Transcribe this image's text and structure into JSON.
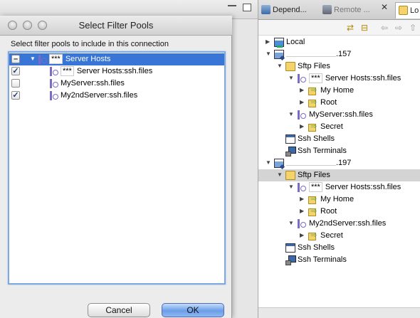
{
  "right_view": {
    "tabs": [
      "Depend...",
      "Remote ...",
      "Lo"
    ],
    "close_glyph": "✕",
    "tree": [
      {
        "label": "Local",
        "icon": "local-system-icon"
      },
      {
        "label": ".157",
        "icon": "remote-host-icon"
      },
      {
        "label": "Sftp Files",
        "icon": "folder-icon"
      },
      {
        "stars": "***",
        "label": "Server Hosts:ssh.files",
        "icon": "filter-pool-icon"
      },
      {
        "label": "My Home",
        "icon": "filter-icon"
      },
      {
        "label": "Root",
        "icon": "filter-icon"
      },
      {
        "label": "MyServer:ssh.files",
        "icon": "filter-pool-icon"
      },
      {
        "label": "Secret",
        "icon": "filter-icon"
      },
      {
        "label": "Ssh Shells",
        "icon": "shell-icon"
      },
      {
        "label": "Ssh Terminals",
        "icon": "terminal-icon"
      },
      {
        "label": ".197",
        "icon": "remote-host-icon"
      },
      {
        "label": "Sftp Files",
        "icon": "folder-icon"
      },
      {
        "stars": "***",
        "label": "Server Hosts:ssh.files",
        "icon": "filter-pool-icon"
      },
      {
        "label": "My Home",
        "icon": "filter-icon"
      },
      {
        "label": "Root",
        "icon": "filter-icon"
      },
      {
        "label": "My2ndServer:ssh.files",
        "icon": "filter-pool-icon"
      },
      {
        "label": "Secret",
        "icon": "filter-icon"
      },
      {
        "label": "Ssh Shells",
        "icon": "shell-icon"
      },
      {
        "label": "Ssh Terminals",
        "icon": "terminal-icon"
      }
    ]
  },
  "dialog": {
    "title": "Select Filter Pools",
    "instruction": "Select filter pools to include in this connection",
    "items": [
      {
        "stars": "***",
        "label": "Server Hosts",
        "state": "mixed"
      },
      {
        "stars": "***",
        "label": "Server Hosts:ssh.files",
        "state": "checked"
      },
      {
        "label": "MyServer:ssh.files",
        "state": "unchecked"
      },
      {
        "label": "My2ndServer:ssh.files",
        "state": "checked"
      }
    ],
    "buttons": {
      "cancel": "Cancel",
      "ok": "OK"
    }
  },
  "colors": {
    "selection": "#3875d7",
    "ok_button": "#6a9ee8",
    "folder": "#f4d36a"
  }
}
